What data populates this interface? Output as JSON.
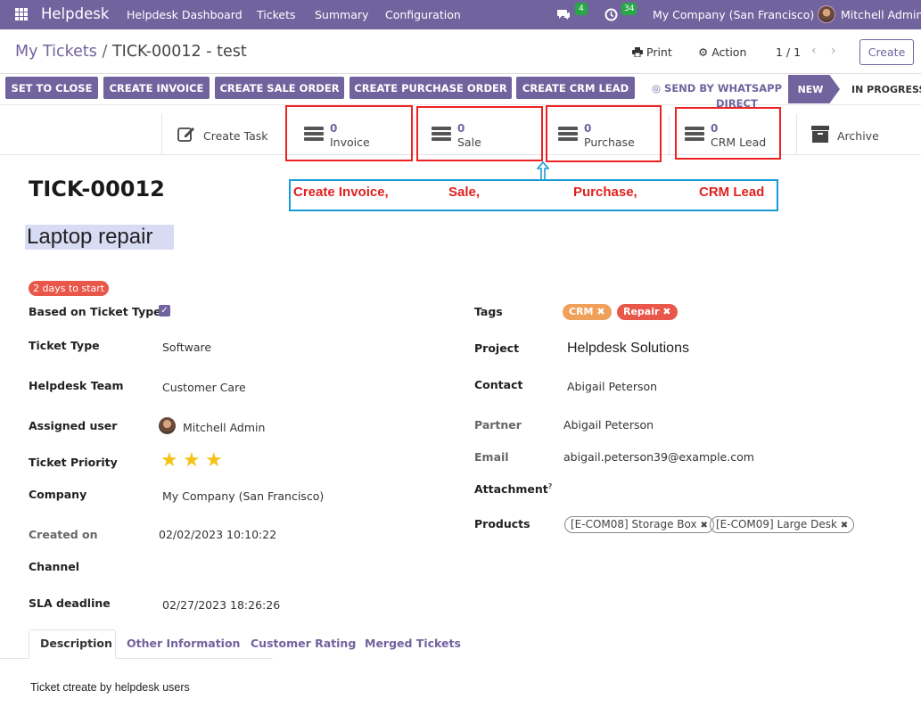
{
  "navbar": {
    "app_name": "Helpdesk",
    "menu": [
      "Helpdesk Dashboard",
      "Tickets",
      "Summary",
      "Configuration"
    ],
    "chat_count": "4",
    "activity_count": "34",
    "company": "My Company (San Francisco)",
    "user": "Mitchell Admin",
    "bg_color": "#71639e"
  },
  "breadcrumb": {
    "parent": "My Tickets",
    "separator": "/",
    "current": "TICK-00012 - test"
  },
  "toolbar": {
    "print_label": "Print",
    "action_label": "Action",
    "pager": "1 / 1",
    "create_label": "Create"
  },
  "status_buttons": [
    "SET TO CLOSE",
    "CREATE INVOICE",
    "CREATE SALE ORDER",
    "CREATE PURCHASE ORDER",
    "CREATE CRM LEAD"
  ],
  "whatsapp": {
    "line1": "SEND BY WHATSAPP",
    "line2": "DIRECT"
  },
  "stages": {
    "current": "NEW",
    "next": "IN PROGRESS"
  },
  "smart_buttons": {
    "task": "Create Task",
    "invoice": {
      "count": "0",
      "label": "Invoice"
    },
    "sale": {
      "count": "0",
      "label": "Sale"
    },
    "purchase": {
      "count": "0",
      "label": "Purchase"
    },
    "crm": {
      "count": "0",
      "label": "CRM Lead"
    },
    "archive": "Archive"
  },
  "callouts": [
    "Create Invoice,",
    "Sale,",
    "Purchase,",
    "CRM Lead"
  ],
  "form": {
    "reference": "TICK-00012",
    "name": "Laptop repair",
    "sla_badge": "2 days to start",
    "left": {
      "based_on_type_label": "Based on Ticket Type",
      "ticket_type_label": "Ticket Type",
      "ticket_type": "Software",
      "team_label": "Helpdesk Team",
      "team": "Customer Care",
      "assigned_label": "Assigned user",
      "assigned": "Mitchell Admin",
      "priority_label": "Ticket Priority",
      "priority_stars": 3,
      "company_label": "Company",
      "company": "My Company (San Francisco)",
      "created_label": "Created on",
      "created": "02/02/2023 10:10:22",
      "channel_label": "Channel",
      "sla_deadline_label": "SLA deadline",
      "sla_deadline": "02/27/2023 18:26:26"
    },
    "right": {
      "tags_label": "Tags",
      "tags": [
        {
          "name": "CRM",
          "color": "#f0a05a"
        },
        {
          "name": "Repair",
          "color": "#e9564a"
        }
      ],
      "project_label": "Project",
      "project": "Helpdesk Solutions",
      "contact_label": "Contact",
      "contact": "Abigail Peterson",
      "partner_label": "Partner",
      "partner": "Abigail Peterson",
      "email_label": "Email",
      "email": "abigail.peterson39@example.com",
      "attachment_label": "Attachment",
      "attachment_help": "?",
      "products_label": "Products",
      "products": [
        "[E-COM08] Storage Box",
        "[E-COM09] Large Desk"
      ]
    }
  },
  "tabs": [
    "Description",
    "Other Information",
    "Customer Rating",
    "Merged Tickets"
  ],
  "description": "Ticket ctreate by helpdesk users"
}
